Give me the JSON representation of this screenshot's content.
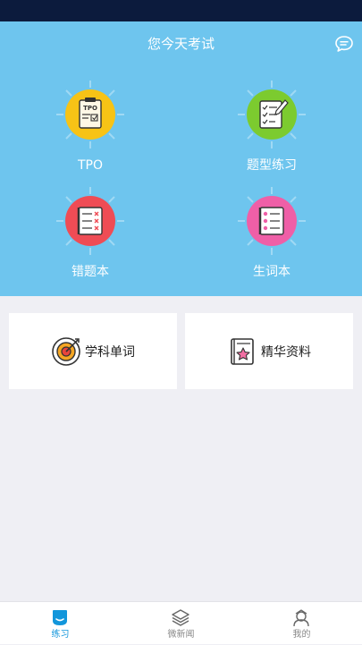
{
  "header": {
    "title": "您今天考试"
  },
  "features": [
    {
      "label": "TPO",
      "icon": "tpo-clipboard-icon",
      "color": "#f7c316"
    },
    {
      "label": "题型练习",
      "icon": "checklist-pencil-icon",
      "color": "#7ccb2f"
    },
    {
      "label": "错题本",
      "icon": "wrong-answers-icon",
      "color": "#ef4c55"
    },
    {
      "label": "生词本",
      "icon": "vocabulary-icon",
      "color": "#ef5fa7"
    }
  ],
  "cards": [
    {
      "label": "学科单词",
      "icon": "target-icon"
    },
    {
      "label": "精华资料",
      "icon": "book-star-icon"
    }
  ],
  "tabs": [
    {
      "label": "练习",
      "icon": "practice-icon",
      "active": true
    },
    {
      "label": "微新闻",
      "icon": "layers-icon",
      "active": false
    },
    {
      "label": "我的",
      "icon": "profile-icon",
      "active": false
    }
  ],
  "colors": {
    "hero": "#6ec5ee",
    "accent": "#1296db",
    "status_bar": "#0c1b3d"
  }
}
